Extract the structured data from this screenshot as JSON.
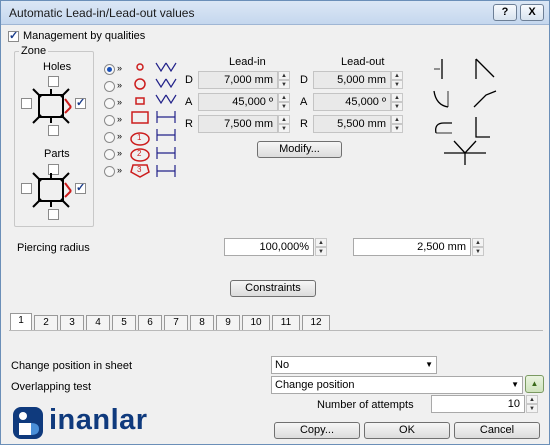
{
  "window": {
    "title": "Automatic Lead-in/Lead-out values",
    "help": "?",
    "close": "X"
  },
  "management": {
    "label": "Management by qualities",
    "checked": true
  },
  "zone": {
    "legend": "Zone",
    "holes_label": "Holes",
    "parts_label": "Parts"
  },
  "headers": {
    "lead_in": "Lead-in",
    "lead_out": "Lead-out"
  },
  "arrow_mark": "»",
  "lead_in": {
    "D": {
      "label": "D",
      "value": "7,000 mm"
    },
    "A": {
      "label": "A",
      "value": "45,000 º"
    },
    "R": {
      "label": "R",
      "value": "7,500 mm"
    }
  },
  "lead_out": {
    "D": {
      "label": "D",
      "value": "5,000 mm"
    },
    "A": {
      "label": "A",
      "value": "45,000 º"
    },
    "R": {
      "label": "R",
      "value": "5,500 mm"
    }
  },
  "shape_badges": [
    "1",
    "2",
    "3"
  ],
  "modify_button": "Modify...",
  "piercing": {
    "label": "Piercing radius",
    "percent": "100,000%",
    "value": "2,500 mm"
  },
  "constraints_button": "Constraints",
  "tabs": [
    "1",
    "2",
    "3",
    "4",
    "5",
    "6",
    "7",
    "8",
    "9",
    "10",
    "11",
    "12"
  ],
  "change_position": {
    "label": "Change position in sheet",
    "value": "No"
  },
  "overlapping": {
    "label": "Overlapping test",
    "value": "Change position"
  },
  "attempts": {
    "label": "Number of attempts",
    "value": "10"
  },
  "brand": "inanlar",
  "footer": {
    "copy": "Copy...",
    "ok": "OK",
    "cancel": "Cancel"
  },
  "colors": {
    "accent_red": "#cc1d1d",
    "icon_blue": "#22228a",
    "brand_blue": "#0f3a7d"
  }
}
